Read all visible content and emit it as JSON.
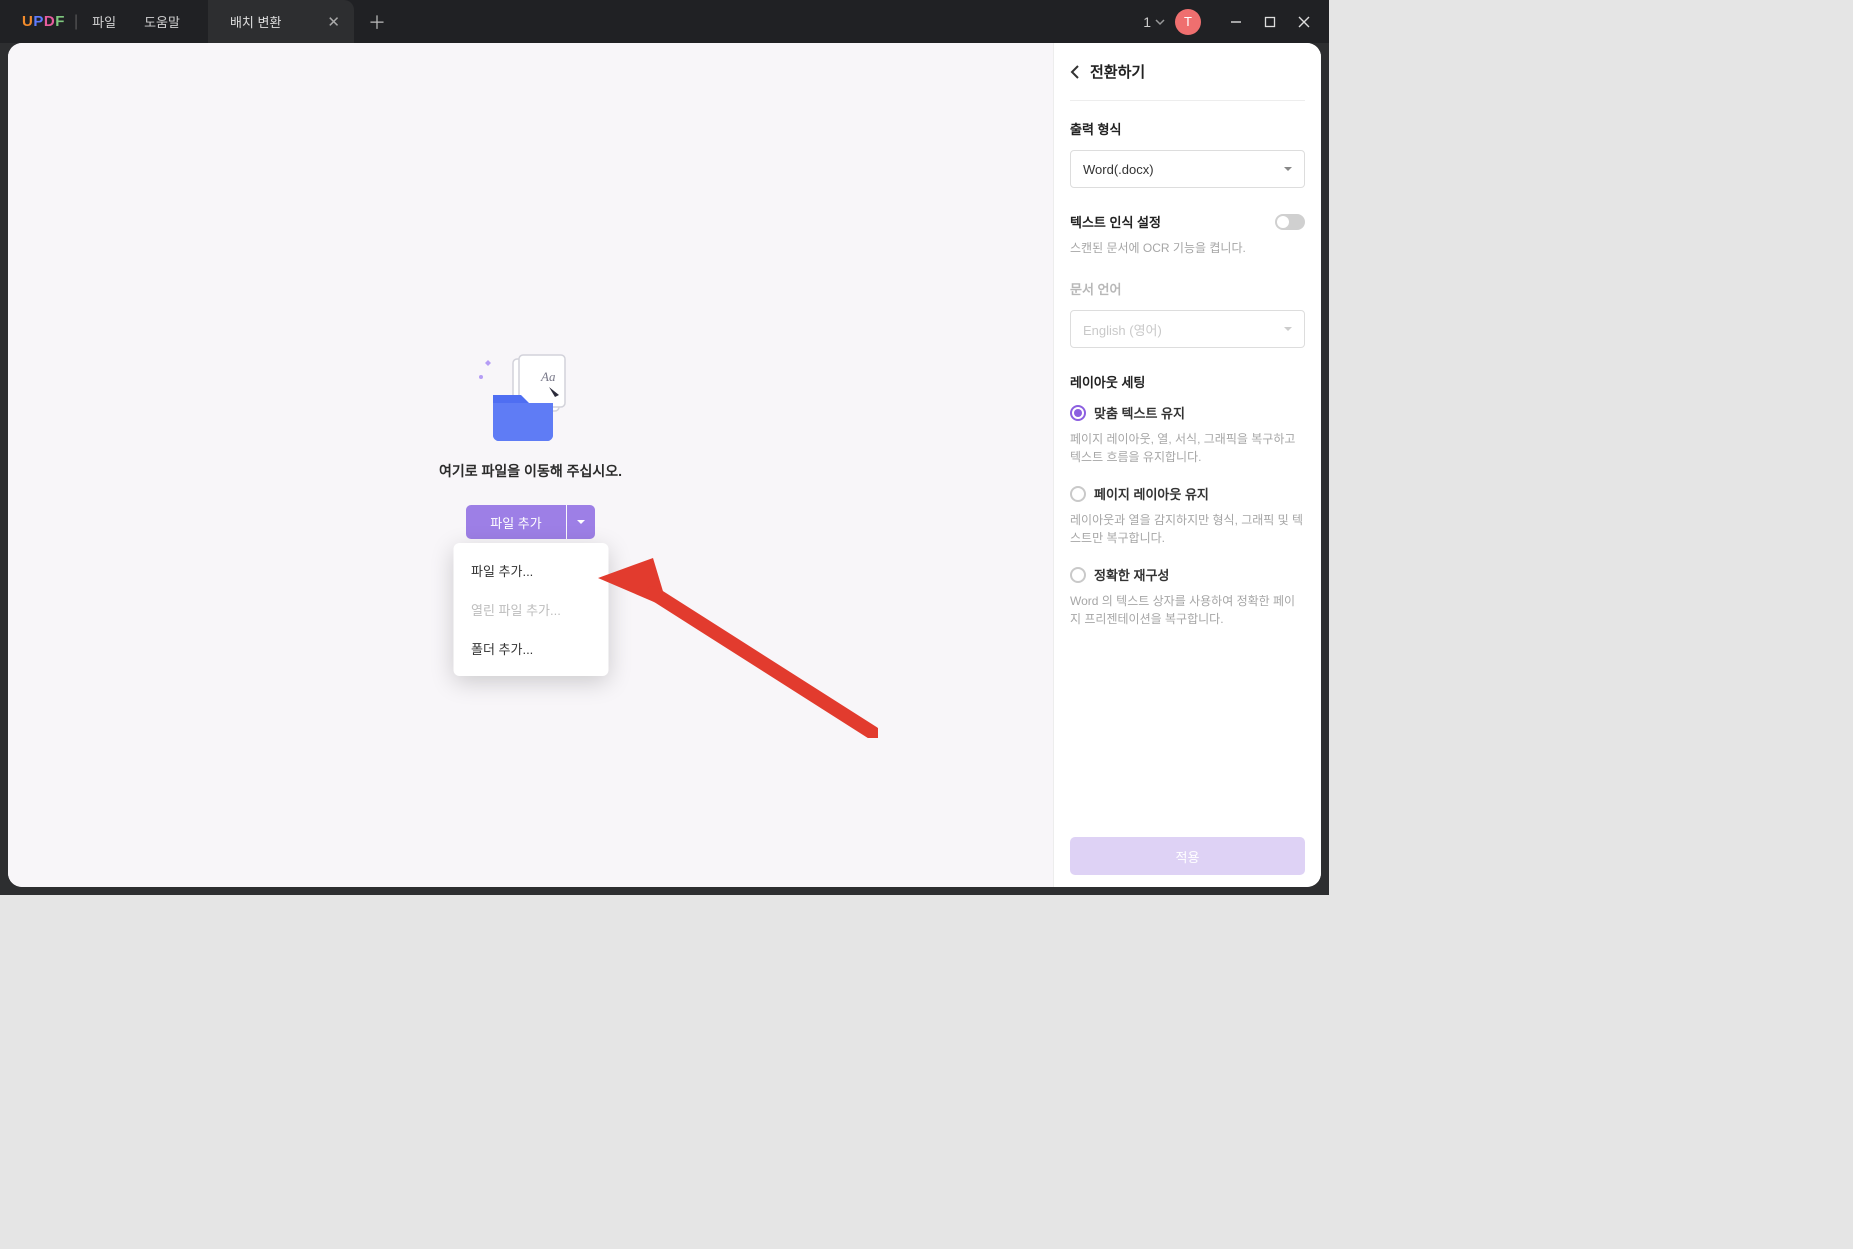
{
  "app": {
    "logo": {
      "u": "U",
      "p": "P",
      "d": "D",
      "f": "F"
    }
  },
  "menu": {
    "file": "파일",
    "help": "도움말"
  },
  "tab": {
    "title": "배치 변환"
  },
  "titlebar": {
    "count": "1",
    "avatar_initial": "T"
  },
  "dropzone": {
    "text": "여기로 파일을 이동해 주십시오.",
    "add_button": "파일 추가"
  },
  "dropdown": {
    "add_file": "파일 추가...",
    "add_open_file": "열린 파일 추가...",
    "add_folder": "폴더 추가..."
  },
  "side": {
    "convert_title": "전환하기",
    "output_format_label": "출력 형식",
    "output_format_value": "Word(.docx)",
    "ocr": {
      "label": "텍스트 인식 설정",
      "hint": "스캔된 문서에 OCR 기능을 켭니다."
    },
    "doc_lang_label": "문서 언어",
    "doc_lang_value": "English (영어)",
    "layout_label": "레이아웃 세팅",
    "options": {
      "keep_text": {
        "label": "맞춤 텍스트 유지",
        "hint": "페이지 레이아웃, 열, 서식, 그래픽을 복구하고 텍스트 흐름을 유지합니다."
      },
      "keep_layout": {
        "label": "페이지 레이아웃 유지",
        "hint": "레이아웃과 열을 감지하지만 형식, 그래픽 및 텍스트만 복구합니다."
      },
      "exact": {
        "label": "정확한 재구성",
        "hint": "Word 의 텍스트 상자를 사용하여 정확한 페이지 프리젠테이션을 복구합니다."
      }
    },
    "apply": "적용"
  }
}
